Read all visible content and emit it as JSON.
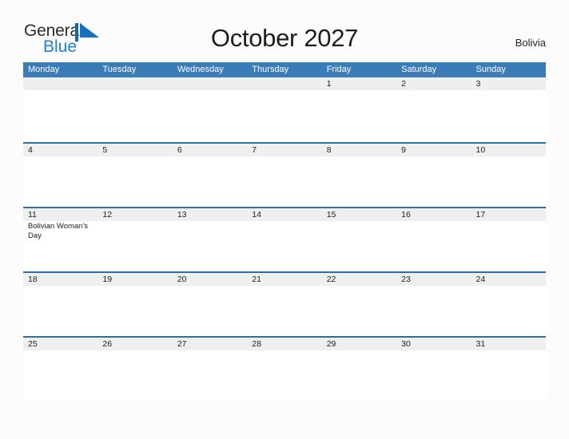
{
  "brand": {
    "word_general": "General",
    "word_blue": "Blue",
    "mark_icon": "triangle-flag-icon",
    "accent_color": "#1b7fd4"
  },
  "header": {
    "title": "October 2027",
    "country": "Bolivia"
  },
  "theme": {
    "header_bar_color": "#3b7cb8",
    "week_rule_color": "#2b6fad",
    "band_color": "#efefef",
    "page_background": "#fcfcfc"
  },
  "calendar": {
    "weekday_headers": [
      "Monday",
      "Tuesday",
      "Wednesday",
      "Thursday",
      "Friday",
      "Saturday",
      "Sunday"
    ],
    "weeks": [
      [
        {
          "day": "",
          "event": ""
        },
        {
          "day": "",
          "event": ""
        },
        {
          "day": "",
          "event": ""
        },
        {
          "day": "",
          "event": ""
        },
        {
          "day": "1",
          "event": ""
        },
        {
          "day": "2",
          "event": ""
        },
        {
          "day": "3",
          "event": ""
        }
      ],
      [
        {
          "day": "4",
          "event": ""
        },
        {
          "day": "5",
          "event": ""
        },
        {
          "day": "6",
          "event": ""
        },
        {
          "day": "7",
          "event": ""
        },
        {
          "day": "8",
          "event": ""
        },
        {
          "day": "9",
          "event": ""
        },
        {
          "day": "10",
          "event": ""
        }
      ],
      [
        {
          "day": "11",
          "event": "Bolivian Woman's Day"
        },
        {
          "day": "12",
          "event": ""
        },
        {
          "day": "13",
          "event": ""
        },
        {
          "day": "14",
          "event": ""
        },
        {
          "day": "15",
          "event": ""
        },
        {
          "day": "16",
          "event": ""
        },
        {
          "day": "17",
          "event": ""
        }
      ],
      [
        {
          "day": "18",
          "event": ""
        },
        {
          "day": "19",
          "event": ""
        },
        {
          "day": "20",
          "event": ""
        },
        {
          "day": "21",
          "event": ""
        },
        {
          "day": "22",
          "event": ""
        },
        {
          "day": "23",
          "event": ""
        },
        {
          "day": "24",
          "event": ""
        }
      ],
      [
        {
          "day": "25",
          "event": ""
        },
        {
          "day": "26",
          "event": ""
        },
        {
          "day": "27",
          "event": ""
        },
        {
          "day": "28",
          "event": ""
        },
        {
          "day": "29",
          "event": ""
        },
        {
          "day": "30",
          "event": ""
        },
        {
          "day": "31",
          "event": ""
        }
      ]
    ]
  }
}
